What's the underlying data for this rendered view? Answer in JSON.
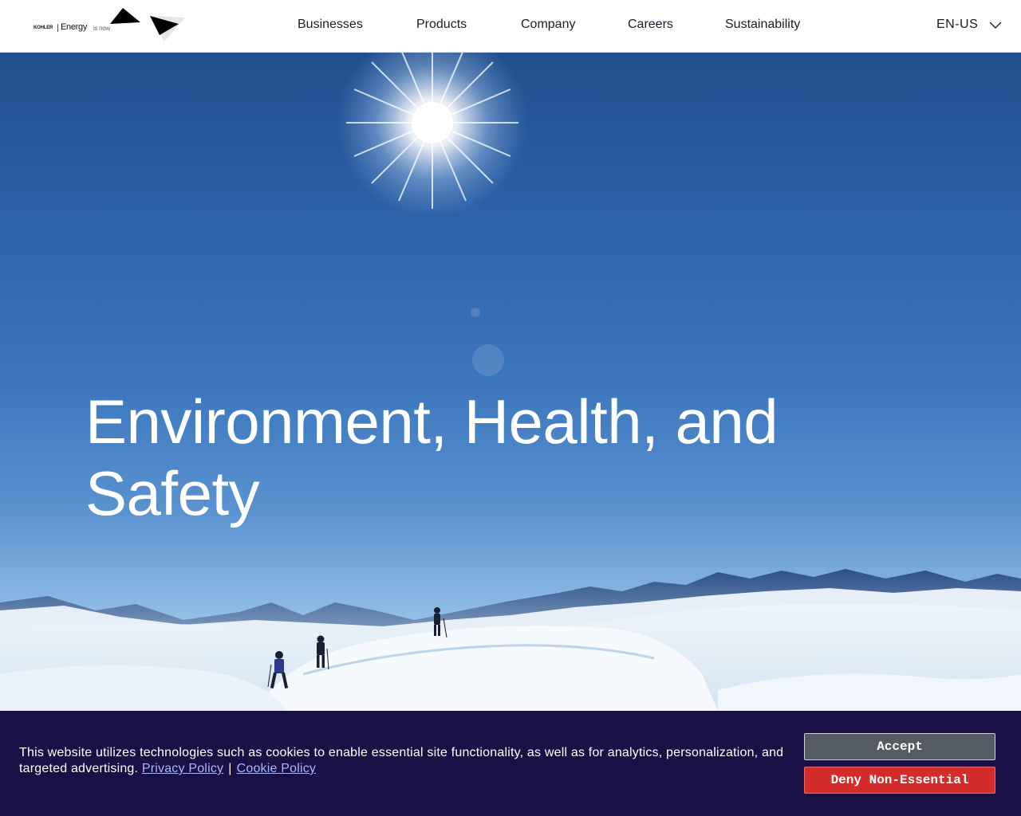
{
  "header": {
    "logo": {
      "brand": "KOHLER",
      "energy": "Energy",
      "is_now": "is now"
    },
    "nav": [
      {
        "label": "Businesses"
      },
      {
        "label": "Products"
      },
      {
        "label": "Company"
      },
      {
        "label": "Careers"
      },
      {
        "label": "Sustainability"
      }
    ],
    "language": {
      "label": "EN-US",
      "icon": "chevron-down-icon"
    }
  },
  "hero": {
    "title": "Environment, Health, and Safety",
    "image": "snowfield-hikers-under-sun"
  },
  "cookie_banner": {
    "text": "This website utilizes technologies such as cookies to enable essential site functionality, as well as for analytics, personalization, and targeted advertising.",
    "privacy_link": "Privacy Policy",
    "separator": "|",
    "cookie_link": "Cookie Policy",
    "accept_label": "Accept",
    "deny_label": "Deny Non-Essential",
    "colors": {
      "background": "#1b1046",
      "accept": "#545b63",
      "deny": "#d42b2b",
      "link": "#a9b9ff"
    }
  }
}
